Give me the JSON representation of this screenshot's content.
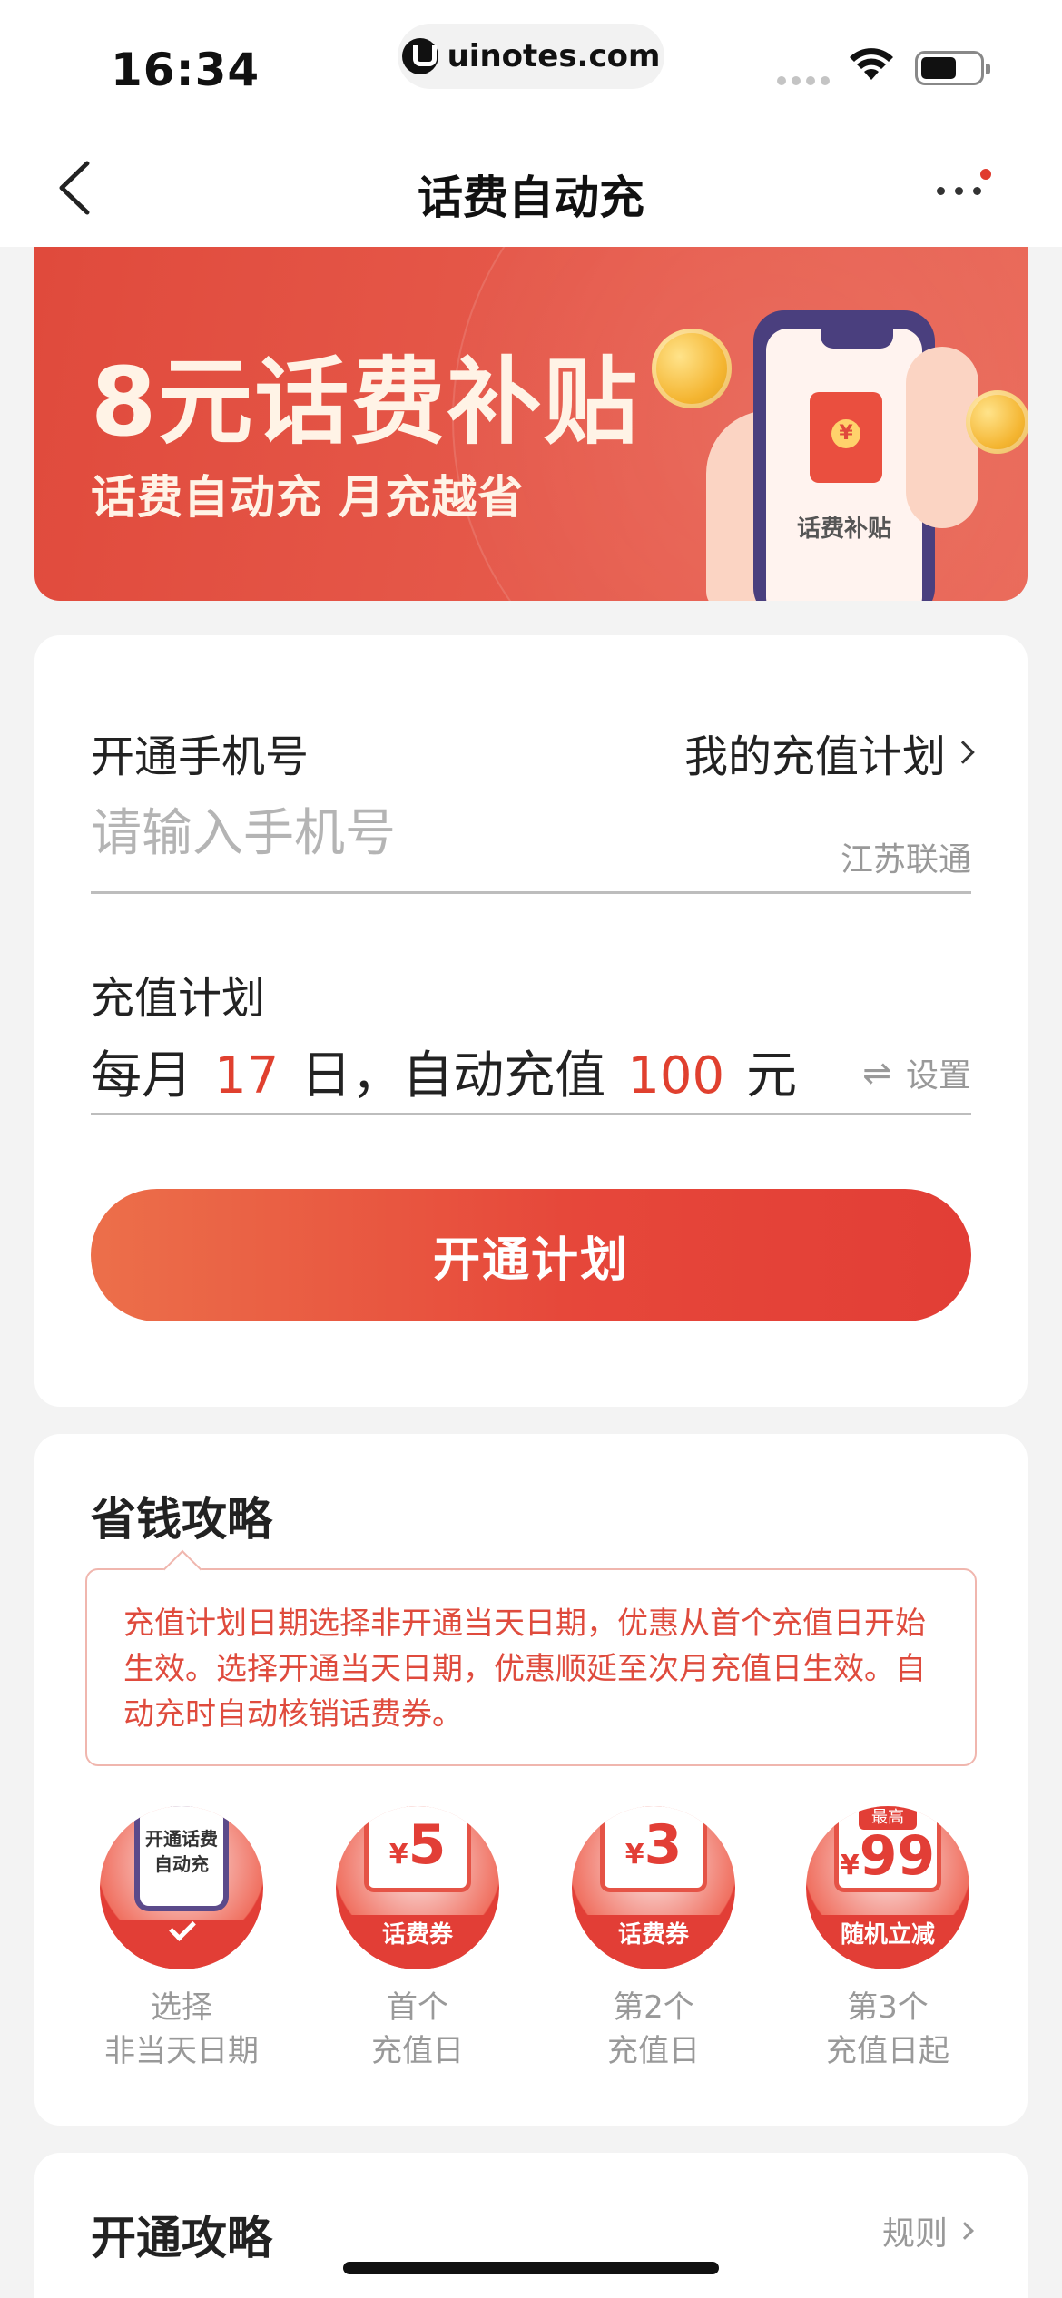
{
  "status_bar": {
    "time": "16:34",
    "url": "uinotes.com"
  },
  "nav": {
    "title": "话费自动充"
  },
  "banner": {
    "title": "8元话费补贴",
    "subtitle": "话费自动充 月充越省",
    "phone_label": "话费补贴"
  },
  "form": {
    "phone_label": "开通手机号",
    "plan_link": "我的充值计划",
    "phone_placeholder": "请输入手机号",
    "phone_value": "",
    "carrier": "江苏联通",
    "plan_label": "充值计划",
    "plan_prefix": "每月",
    "plan_day": "17",
    "plan_middle": "日，自动充值",
    "plan_amount": "100",
    "plan_suffix": "元",
    "settings_label": "设置",
    "cta_label": "开通计划"
  },
  "savings": {
    "title": "省钱攻略",
    "tip": "充值计划日期选择非开通当天日期，优惠从首个充值日开始生效。选择开通当天日期，优惠顺延至次月充值日生效。自动充时自动核销话费券。",
    "steps": [
      {
        "badge_text": "开通话费自动充",
        "line1": "选择",
        "line2": "非当天日期"
      },
      {
        "currency": "¥",
        "amount": "5",
        "band": "话费券",
        "line1": "首个",
        "line2": "充值日"
      },
      {
        "currency": "¥",
        "amount": "3",
        "band": "话费券",
        "line1": "第2个",
        "line2": "充值日"
      },
      {
        "ribbon": "最高",
        "currency": "¥",
        "amount": "99",
        "band": "随机立减",
        "line1": "第3个",
        "line2": "充值日起"
      }
    ]
  },
  "guide": {
    "title": "开通攻略",
    "rules_label": "规则"
  },
  "colors": {
    "accent": "#e23e36",
    "banner": "#e04a3c",
    "muted": "#999999"
  }
}
